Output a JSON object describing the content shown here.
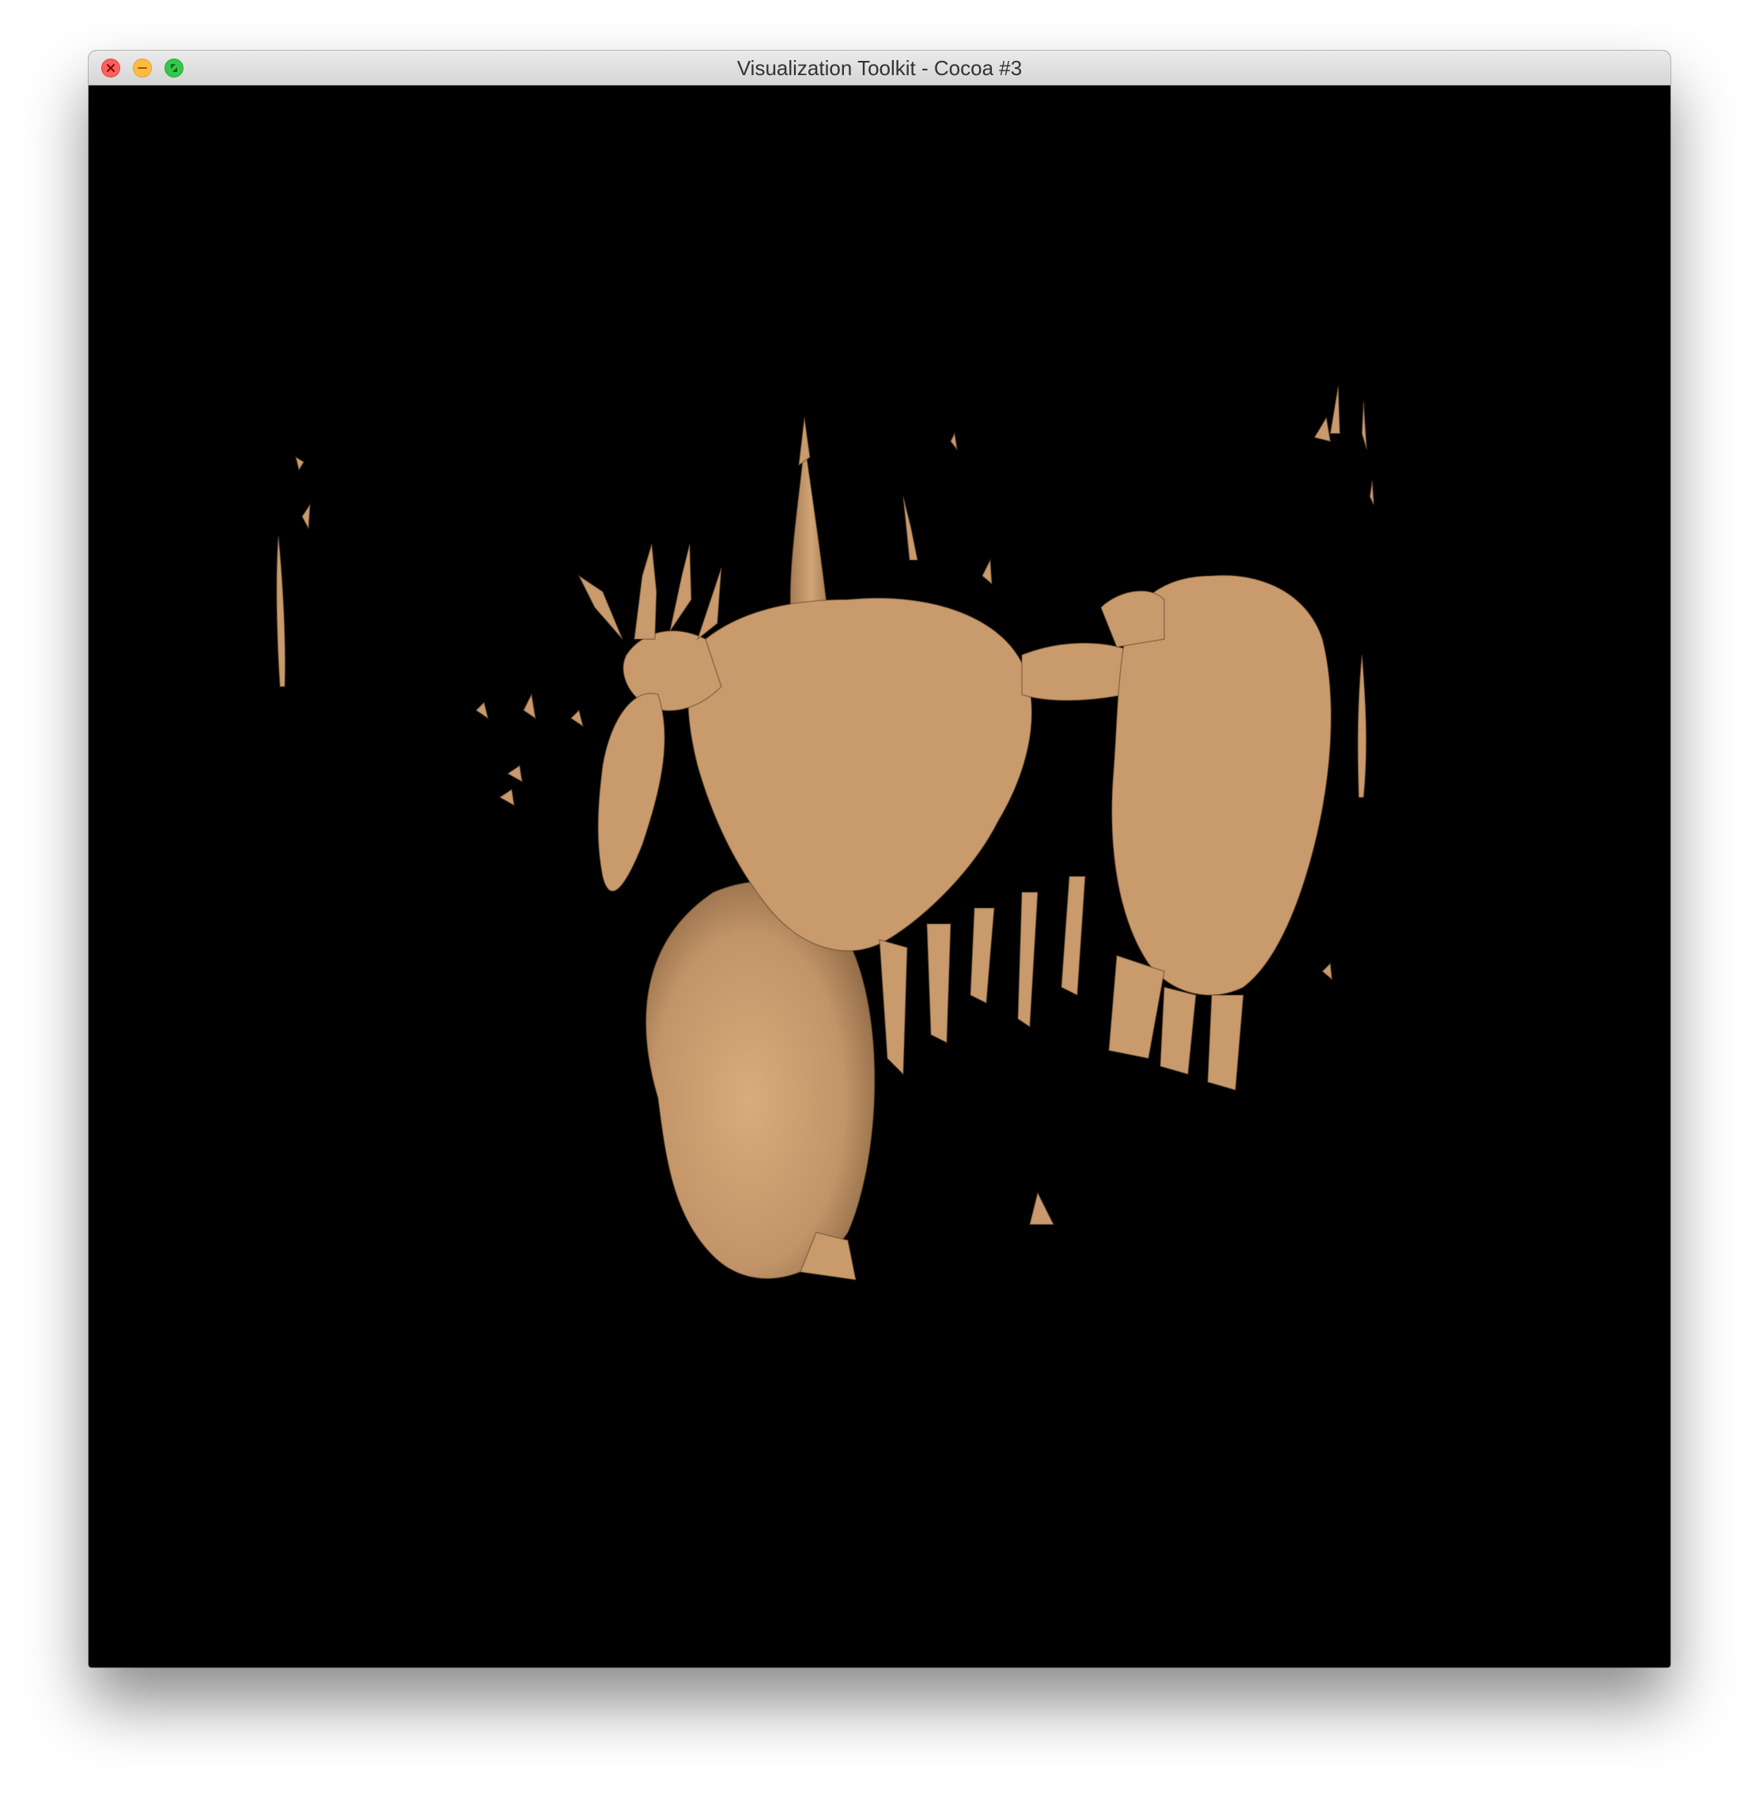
{
  "window": {
    "title": "Visualization Toolkit - Cocoa #3",
    "controls": {
      "close": "close-icon",
      "minimize": "minimize-icon",
      "zoom": "fullscreen-icon"
    }
  },
  "render_view": {
    "background_color": "#000000",
    "surface_color": "#c89a6c",
    "content": "isosurface-render"
  }
}
